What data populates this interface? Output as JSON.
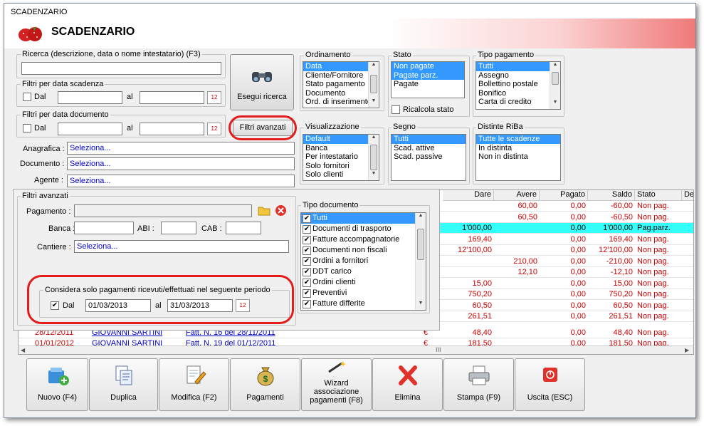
{
  "window": {
    "title": "SCADENZARIO"
  },
  "header": {
    "title": "SCADENZARIO"
  },
  "search": {
    "legend": "Ricerca (descrizione, data o nome intestatario) (F3)",
    "value": ""
  },
  "filter_due": {
    "legend": "Filtri per data scadenza",
    "dal": "Dal",
    "al": "al",
    "from": "",
    "to": "",
    "checked": false
  },
  "filter_doc": {
    "legend": "Filtri per data documento",
    "dal": "Dal",
    "al": "al",
    "from": "",
    "to": "",
    "checked": false
  },
  "search_button": {
    "label": "Esegui ricerca"
  },
  "advanced_button": {
    "label": "Filtri avanzati"
  },
  "calendar_icon_text": "12",
  "ordinamento": {
    "legend": "Ordinamento",
    "items": [
      "Data",
      "Cliente/Fornitore",
      "Stato pagamento",
      "Documento",
      "Ord. di inserimento"
    ],
    "selected": 0
  },
  "stato": {
    "legend": "Stato",
    "items": [
      "Non pagate",
      "Pagate parz.",
      "Pagate"
    ],
    "recalc": "Ricalcola stato"
  },
  "tipo_pagamento": {
    "legend": "Tipo pagamento",
    "items": [
      "Tutti",
      "Assegno",
      "Bollettino postale",
      "Bonifico",
      "Carta di credito"
    ]
  },
  "visualizzazione": {
    "legend": "Visualizzazione",
    "items": [
      "Default",
      "Banca",
      "Per intestatario",
      "Solo fornitori",
      "Solo clienti"
    ]
  },
  "segno": {
    "legend": "Segno",
    "items": [
      "Tutti",
      "Scad. attive",
      "Scad. passive"
    ]
  },
  "distinte": {
    "legend": "Distinte RiBa",
    "items": [
      "Tutte le scadenze",
      "In distinta",
      "Non in distinta"
    ]
  },
  "fields": {
    "anagrafica": {
      "label": "Anagrafica :",
      "value": "Seleziona..."
    },
    "documento": {
      "label": "Documento :",
      "value": "Seleziona..."
    },
    "agente": {
      "label": "Agente :",
      "value": "Seleziona..."
    }
  },
  "advanced": {
    "legend": "Filtri avanzati",
    "pagamento": "Pagamento :",
    "banca": "Banca :",
    "abi": "ABI :",
    "cab": "CAB :",
    "cantiere": "Cantiere :",
    "cantiere_value": "Seleziona...",
    "period_legend": "Considera solo pagamenti ricevuti/effettuati nel seguente periodo",
    "dal": "Dal",
    "al": "al",
    "from": "01/03/2013",
    "to": "31/03/2013"
  },
  "tipo_documento": {
    "legend": "Tipo documento",
    "items": [
      "Tutti",
      "Documenti di trasporto",
      "Fatture accompagnatorie",
      "Documenti non fiscali",
      "Ordini a fornitori",
      "DDT carico",
      "Ordini clienti",
      "Preventivi",
      "Fatture differite"
    ]
  },
  "grid": {
    "columns": [
      "Dare",
      "Avere",
      "Pagato",
      "Saldo",
      "Stato",
      "De"
    ],
    "rows": [
      {
        "dare": "",
        "avere": "60,00",
        "pagato": "0,00",
        "saldo": "-60,00",
        "stato": "Non pag.",
        "highlight": false
      },
      {
        "dare": "",
        "avere": "60,50",
        "pagato": "0,00",
        "saldo": "-60,50",
        "stato": "Non pag.",
        "highlight": false
      },
      {
        "dare": "1'000,00",
        "avere": "",
        "pagato": "0,00",
        "saldo": "1'000,00",
        "stato": "Pag.parz.",
        "highlight": true
      },
      {
        "dare": "169,40",
        "avere": "",
        "pagato": "0,00",
        "saldo": "169,40",
        "stato": "Non pag.",
        "highlight": false
      },
      {
        "dare": "12'100,00",
        "avere": "",
        "pagato": "0,00",
        "saldo": "12'100,00",
        "stato": "Non pag.",
        "highlight": false
      },
      {
        "dare": "",
        "avere": "210,00",
        "pagato": "0,00",
        "saldo": "-210,00",
        "stato": "Non pag.",
        "highlight": false
      },
      {
        "dare": "",
        "avere": "12,10",
        "pagato": "0,00",
        "saldo": "-12,10",
        "stato": "Non pag.",
        "highlight": false
      },
      {
        "dare": "15,00",
        "avere": "",
        "pagato": "0,00",
        "saldo": "15,00",
        "stato": "Non pag.",
        "highlight": false
      },
      {
        "dare": "750,20",
        "avere": "",
        "pagato": "0,00",
        "saldo": "750,20",
        "stato": "Non pag.",
        "highlight": false
      },
      {
        "dare": "60,50",
        "avere": "",
        "pagato": "0,00",
        "saldo": "60,50",
        "stato": "Non pag.",
        "highlight": false
      },
      {
        "dare": "261,51",
        "avere": "",
        "pagato": "0,00",
        "saldo": "261,51",
        "stato": "Non pag.",
        "highlight": false
      }
    ],
    "full_rows": [
      {
        "data": "28/12/2011",
        "nome": "GIOVANNI SARTINI",
        "doc": "Fatt. N. 16 del 28/11/2011",
        "valuta": "€",
        "dare": "48,40",
        "avere": "",
        "pagato": "0,00",
        "saldo": "48,40",
        "stato": "Non pag."
      },
      {
        "data": "01/01/2012",
        "nome": "GIOVANNI SARTINI",
        "doc": "Fatt. N. 19 del 01/12/2011",
        "valuta": "€",
        "dare": "181,50",
        "avere": "",
        "pagato": "0,00",
        "saldo": "181,50",
        "stato": "Non pag."
      }
    ],
    "hscroll_grip": "III"
  },
  "toolbar": {
    "nuovo": "Nuovo (F4)",
    "duplica": "Duplica",
    "modifica": "Modifica (F2)",
    "pagamenti": "Pagamenti",
    "wizard": "Wizard associazione pagamenti (F8)",
    "elimina": "Elimina",
    "stampa": "Stampa (F9)",
    "uscita": "Uscita (ESC)"
  },
  "colors": {
    "accent": "#e31b1b",
    "selection": "#3399ff",
    "highlight_row": "#33ffff",
    "red_text": "#cc0000",
    "link": "#0000cc"
  }
}
